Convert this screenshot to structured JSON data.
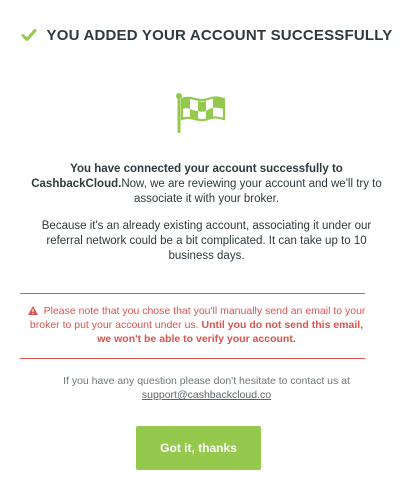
{
  "header": {
    "title": "YOU ADDED YOUR ACCOUNT SUCCESSFULLY",
    "icon": "check-icon"
  },
  "hero": {
    "icon": "flag-icon"
  },
  "message": {
    "bold_intro": "You have connected your account successfully to CashbackCloud.",
    "intro_rest": "Now, we are reviewing your account and we'll try to associate it with your broker.",
    "paragraph2": "Because it's an already existing account, associating it under our referral network could be a bit complicated. It can take up to 10 business days."
  },
  "warning": {
    "icon": "warning-icon",
    "text": "Please note that you chose that you'll manually send an email to your broker to put your account under us.",
    "bold_text": "Until you do not send this email, we won't be able to verify your account."
  },
  "contact": {
    "text": "If you have any question please don't hesitate to contact us at",
    "email": "support@cashbackcloud.co"
  },
  "button": {
    "label": "Got it, thanks"
  },
  "colors": {
    "accent": "#95c94d",
    "warning": "#d9534f",
    "text": "#2f3a3f"
  }
}
